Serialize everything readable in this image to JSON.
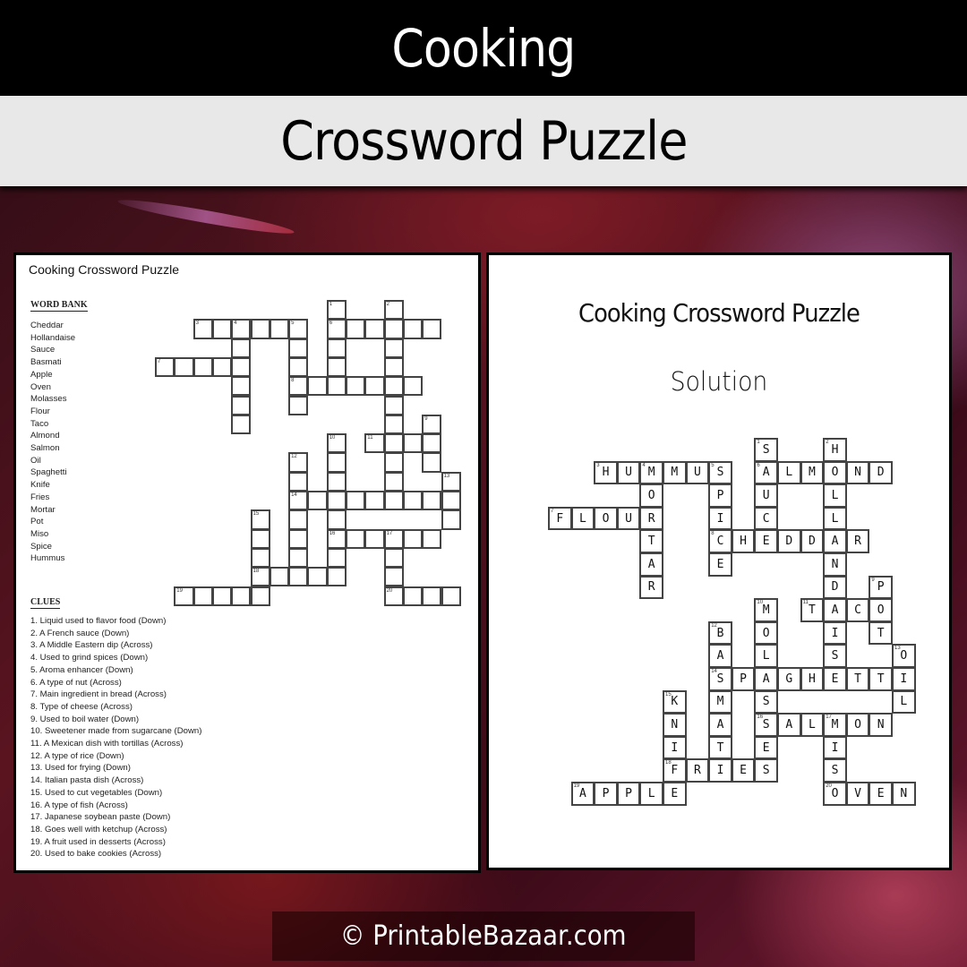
{
  "header": {
    "title": "Cooking",
    "subtitle": "Crossword Puzzle"
  },
  "puzzle_page": {
    "title": "Cooking Crossword Puzzle",
    "word_bank_heading": "WORD BANK",
    "word_bank": [
      "Cheddar",
      "Hollandaise",
      "Sauce",
      "Basmati",
      "Apple",
      "Oven",
      "Molasses",
      "Flour",
      "Taco",
      "Almond",
      "Salmon",
      "Oil",
      "Spaghetti",
      "Knife",
      "Fries",
      "Mortar",
      "Pot",
      "Miso",
      "Spice",
      "Hummus"
    ],
    "clues_heading": "CLUES",
    "clues": [
      "1. Liquid used to flavor food (Down)",
      "2. A French sauce (Down)",
      "3. A Middle Eastern dip (Across)",
      "4. Used to grind spices (Down)",
      "5. Aroma enhancer (Down)",
      "6. A type of nut (Across)",
      "7. Main ingredient in bread (Across)",
      "8. Type of cheese (Across)",
      "9. Used to boil water (Down)",
      "10. Sweetener made from sugarcane (Down)",
      "11. A Mexican dish with tortillas (Across)",
      "12. A type of rice (Down)",
      "13. Used for frying (Down)",
      "14. Italian pasta dish (Across)",
      "15. Used to cut vegetables (Down)",
      "16. A type of fish (Across)",
      "17. Japanese soybean paste (Down)",
      "18. Goes well with ketchup (Across)",
      "19. A fruit used in desserts (Across)",
      "20. Used to bake cookies (Across)"
    ]
  },
  "solution_page": {
    "title": "Cooking Crossword Puzzle",
    "subtitle": "Solution"
  },
  "crossword": {
    "entries": [
      {
        "num": 1,
        "dir": "down",
        "row": 0,
        "col": 9,
        "answer": "SAUCE"
      },
      {
        "num": 2,
        "dir": "down",
        "row": 0,
        "col": 12,
        "answer": "HOLLANDAISE"
      },
      {
        "num": 3,
        "dir": "across",
        "row": 1,
        "col": 2,
        "answer": "HUMMUS"
      },
      {
        "num": 4,
        "dir": "down",
        "row": 1,
        "col": 4,
        "answer": "MORTAR"
      },
      {
        "num": 5,
        "dir": "down",
        "row": 1,
        "col": 7,
        "answer": "SPICE"
      },
      {
        "num": 6,
        "dir": "across",
        "row": 1,
        "col": 9,
        "answer": "ALMOND"
      },
      {
        "num": 7,
        "dir": "across",
        "row": 3,
        "col": 0,
        "answer": "FLOUR"
      },
      {
        "num": 8,
        "dir": "across",
        "row": 4,
        "col": 7,
        "answer": "CHEDDAR"
      },
      {
        "num": 9,
        "dir": "down",
        "row": 6,
        "col": 14,
        "answer": "POT"
      },
      {
        "num": 10,
        "dir": "down",
        "row": 7,
        "col": 9,
        "answer": "MOLASSES"
      },
      {
        "num": 11,
        "dir": "across",
        "row": 7,
        "col": 11,
        "answer": "TACO"
      },
      {
        "num": 12,
        "dir": "down",
        "row": 8,
        "col": 7,
        "answer": "BASMATI"
      },
      {
        "num": 13,
        "dir": "down",
        "row": 9,
        "col": 15,
        "answer": "OIL"
      },
      {
        "num": 14,
        "dir": "across",
        "row": 10,
        "col": 7,
        "answer": "SPAGHETTI"
      },
      {
        "num": 15,
        "dir": "down",
        "row": 11,
        "col": 5,
        "answer": "KNIFE"
      },
      {
        "num": 16,
        "dir": "across",
        "row": 12,
        "col": 9,
        "answer": "SALMON"
      },
      {
        "num": 17,
        "dir": "down",
        "row": 12,
        "col": 12,
        "answer": "MISO"
      },
      {
        "num": 18,
        "dir": "across",
        "row": 14,
        "col": 5,
        "answer": "FRIES"
      },
      {
        "num": 19,
        "dir": "across",
        "row": 15,
        "col": 1,
        "answer": "APPLE"
      },
      {
        "num": 20,
        "dir": "across",
        "row": 15,
        "col": 12,
        "answer": "OVEN"
      }
    ]
  },
  "footer": {
    "copyright": "© PrintableBazaar.com"
  }
}
